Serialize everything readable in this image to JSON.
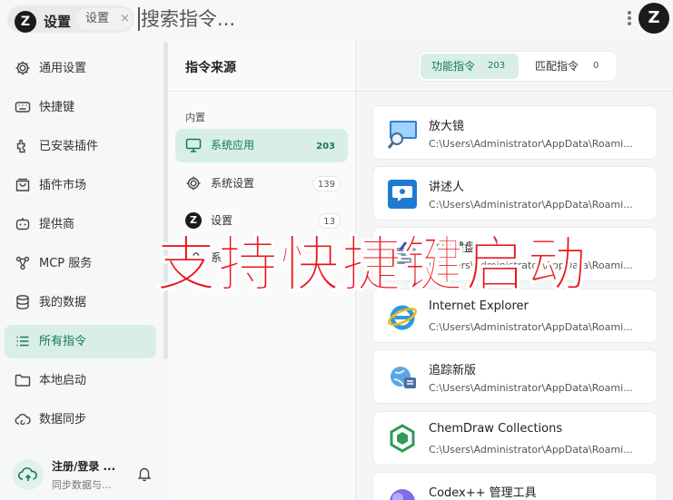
{
  "topbar": {
    "logo_text": "Z",
    "active_tab_title": "设置",
    "tab2_label": "设置",
    "tab2_close": "×",
    "search_placeholder": "搜索指令...",
    "avatar_text": "Z"
  },
  "sidebar": {
    "items": [
      {
        "label": "通用设置",
        "icon": "gear-icon"
      },
      {
        "label": "快捷键",
        "icon": "keyboard-icon"
      },
      {
        "label": "已安装插件",
        "icon": "plugin-icon"
      },
      {
        "label": "插件市场",
        "icon": "store-icon"
      },
      {
        "label": "提供商",
        "icon": "robot-icon"
      },
      {
        "label": "MCP 服务",
        "icon": "network-icon"
      },
      {
        "label": "我的数据",
        "icon": "database-icon"
      },
      {
        "label": "所有指令",
        "icon": "list-icon",
        "active": true
      },
      {
        "label": "本地启动",
        "icon": "folder-icon"
      },
      {
        "label": "数据同步",
        "icon": "sync-cloud-icon"
      }
    ],
    "login_title": "注册/登录 ...",
    "login_sub": "同步数据与..."
  },
  "sources": {
    "title": "指令来源",
    "section": "内置",
    "items": [
      {
        "label": "系统应用",
        "count": "203",
        "active": true
      },
      {
        "label": "系统设置",
        "count": "139"
      },
      {
        "label": "设置",
        "count": "13"
      },
      {
        "label": "系"
      }
    ]
  },
  "commands": {
    "tabs": [
      {
        "label": "功能指令",
        "count": "203",
        "active": true
      },
      {
        "label": "匹配指令",
        "count": "0"
      }
    ],
    "items": [
      {
        "name": "放大镜",
        "path": "C:\\Users\\Administrator\\AppData\\Roami..."
      },
      {
        "name": "讲述人",
        "path": "C:\\Users\\Administrator\\AppData\\Roami..."
      },
      {
        "name": "屏幕键盘",
        "path": "C:\\Users\\Administrator\\AppData\\Roami..."
      },
      {
        "name": "Internet Explorer",
        "path": "C:\\Users\\Administrator\\AppData\\Roami..."
      },
      {
        "name": "追踪新版",
        "path": "C:\\Users\\Administrator\\AppData\\Roami..."
      },
      {
        "name": "ChemDraw Collections",
        "path": "C:\\Users\\Administrator\\AppData\\Roami..."
      },
      {
        "name": "Codex++ 管理工具",
        "path": ""
      }
    ]
  },
  "overlay_caption": "支持快捷键启动",
  "colors": {
    "accent": "#127a55",
    "accent_bg": "#d9efe6",
    "caption": "#e8171d"
  }
}
